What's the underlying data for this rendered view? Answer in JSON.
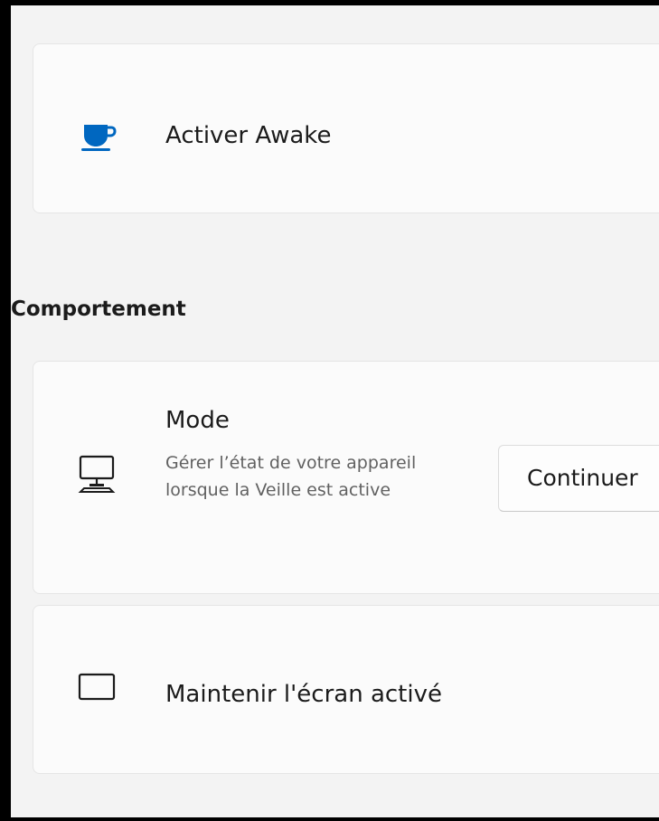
{
  "awake": {
    "enable_label": "Activer Awake",
    "icon": "coffee-cup-icon",
    "icon_color": "#0067c0"
  },
  "behavior": {
    "section_title": "Comportement",
    "mode": {
      "title": "Mode",
      "description": "Gérer l’état de votre appareil lorsque la Veille est active",
      "icon": "monitor-icon",
      "selected_value": "Continuer"
    },
    "keep_screen_on": {
      "label": "Maintenir l'écran activé",
      "icon": "screen-icon"
    }
  }
}
